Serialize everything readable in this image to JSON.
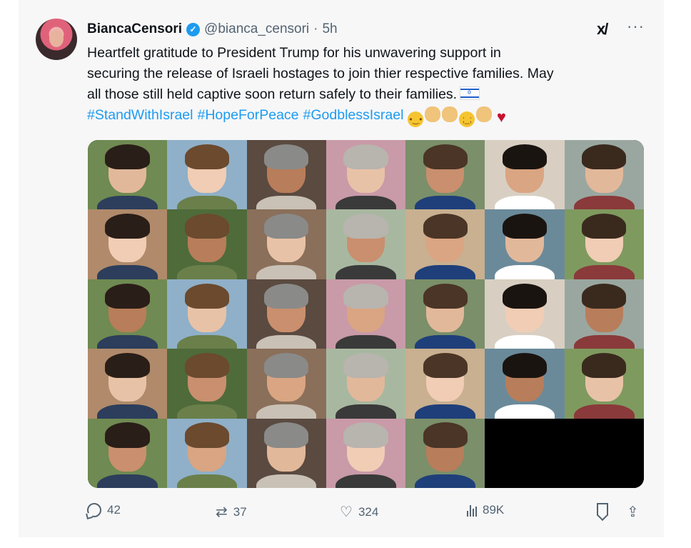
{
  "tweet": {
    "author_name": "BiancaCensori",
    "verified_badge_icon": "verified-check-icon",
    "handle": "@bianca_censori",
    "separator": "·",
    "time": "5h",
    "grok_icon": "grok-logo-icon",
    "more_icon": "more-horizontal-icon",
    "text_lines": [
      "Heartfelt gratitude to President Trump for his unwavering support in",
      "securing the release of Israeli hostages to join thier respective families. May",
      "all those still held captive soon return safely to their families."
    ],
    "flag_icon": "israel-flag-emoji",
    "hashtags": [
      "#StandWithIsrael",
      "#HopeForPeace",
      "#GodblessIsrael"
    ],
    "emojis": [
      "pleading-face-emoji",
      "open-hands-emoji",
      "folded-hands-emoji",
      "crying-face-emoji",
      "clapping-hands-emoji",
      "red-heart-emoji"
    ]
  },
  "media": {
    "rows": 5,
    "columns": 7,
    "photo_count": 33,
    "description_icon": "hostage-portrait-photo"
  },
  "actions": {
    "replies": "42",
    "reposts": "37",
    "likes": "324",
    "views": "89K",
    "icons": {
      "reply": "reply-icon",
      "repost": "repost-icon",
      "like": "heart-icon",
      "views": "views-chart-icon",
      "bookmark": "bookmark-icon",
      "share": "share-icon"
    }
  },
  "colors": {
    "link_blue": "#1d9bf0",
    "text": "#0f1419",
    "muted": "#536471",
    "background": "#f7f7f8"
  }
}
